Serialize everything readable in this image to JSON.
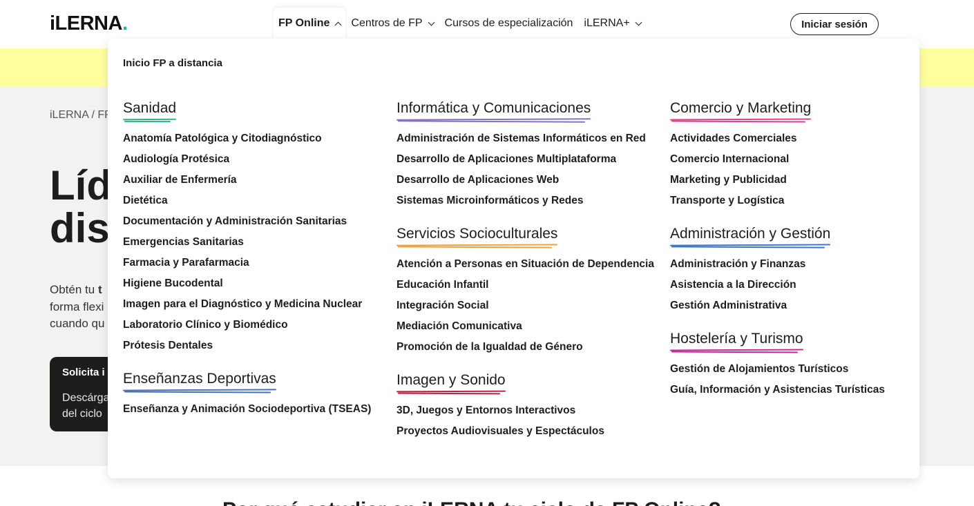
{
  "header": {
    "logo": "iLERNA",
    "logo_dot": ".",
    "nav": [
      {
        "label": "FP Online",
        "active": true
      },
      {
        "label": "Centros de FP"
      },
      {
        "label": "Cursos de especialización"
      },
      {
        "label": "iLERNA+"
      }
    ],
    "login_label": "Iniciar sesión"
  },
  "hero": {
    "breadcrumb": "iLERNA / FP",
    "title_line1": "Líd",
    "title_line2": "dis",
    "text_line1_a": "Obtén tu ",
    "text_line1_b": "t",
    "text_line2": "forma flexi",
    "text_line3": "cuando qu",
    "cta_title": "Solicita i",
    "cta_line1": "Descárga",
    "cta_line2": "del ciclo"
  },
  "below_title": "Por qué estudiar en iLERNA tu ciclo de FP Online?",
  "menu": {
    "home_link": "Inicio FP a distancia",
    "columns": [
      [
        {
          "title": "Sanidad",
          "color": "#2bb58a",
          "items": [
            "Anatomía Patológica y Citodiagnóstico",
            "Audiología Protésica",
            "Auxiliar de Enfermería",
            "Dietética",
            "Documentación y Administración Sanitarias",
            "Emergencias Sanitarias",
            "Farmacia y Parafarmacia",
            "Higiene Bucodental",
            "Imagen para el Diagnóstico y Medicina Nuclear",
            "Laboratorio Clínico y Biomédico",
            "Prótesis Dentales"
          ]
        },
        {
          "title": "Enseñanzas Deportivas",
          "color": "#4a6fb5",
          "items": [
            "Enseñanza y Animación Sociodeportiva (TSEAS)"
          ]
        }
      ],
      [
        {
          "title": "Informática y Comunicaciones",
          "color": "#8a6fc4",
          "items": [
            "Administración de Sistemas Informáticos en Red",
            "Desarrollo de Aplicaciones Multiplataforma",
            "Desarrollo de Aplicaciones Web",
            "Sistemas Microinformáticos y Redes"
          ]
        },
        {
          "title": "Servicios Socioculturales",
          "color": "#f0a236",
          "items": [
            "Atención a Personas en Situación de Dependencia",
            "Educación Infantil",
            "Integración Social",
            "Mediación Comunicativa",
            "Promoción de la Igualdad de Género"
          ]
        },
        {
          "title": "Imagen y Sonido",
          "color": "#c0203c",
          "items": [
            "3D, Juegos y Entornos Interactivos",
            "Proyectos Audiovisuales y Espectáculos"
          ]
        }
      ],
      [
        {
          "title": "Comercio y Marketing",
          "color": "#e0408a",
          "items": [
            "Actividades Comerciales",
            "Comercio Internacional",
            "Marketing y Publicidad",
            "Transporte y Logística"
          ]
        },
        {
          "title": "Administración y Gestión",
          "color": "#3a78c9",
          "items": [
            "Administración y Finanzas",
            "Asistencia a la Dirección",
            "Gestión Administrativa"
          ]
        },
        {
          "title": "Hostelería y Turismo",
          "color": "#c8259a",
          "items": [
            "Gestión de Alojamientos Turísticos",
            "Guía, Información y Asistencias Turísticas"
          ]
        }
      ]
    ]
  }
}
